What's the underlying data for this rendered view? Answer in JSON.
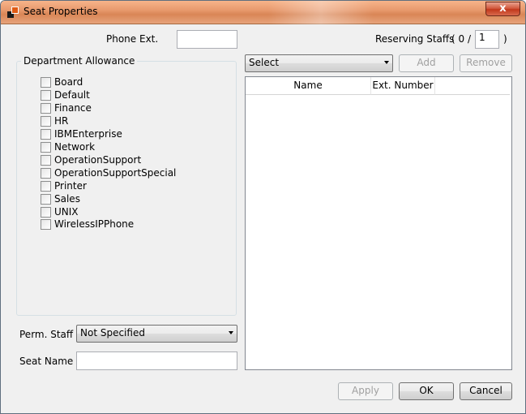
{
  "window": {
    "title": "Seat Properties",
    "close_glyph": "x"
  },
  "phone_ext": {
    "label": "Phone Ext.",
    "value": ""
  },
  "reserving": {
    "label": "Reserving Staffs",
    "open": "( 0 /",
    "value": "1",
    "close": ")"
  },
  "department": {
    "title": "Department Allowance",
    "items": [
      "Board",
      "Default",
      "Finance",
      "HR",
      "IBMEnterprise",
      "Network",
      "OperationSupport",
      "OperationSupportSpecial",
      "Printer",
      "Sales",
      "UNIX",
      "WirelessIPPhone"
    ]
  },
  "staff_select": {
    "value": "Select",
    "add_label": "Add",
    "remove_label": "Remove"
  },
  "staff_list": {
    "columns": [
      "Name",
      "Ext. Number"
    ]
  },
  "perm_staff": {
    "label": "Perm. Staff",
    "value": "Not Specified"
  },
  "seat_name": {
    "label": "Seat Name",
    "value": ""
  },
  "footer": {
    "apply_label": "Apply",
    "ok_label": "OK",
    "cancel_label": "Cancel"
  }
}
